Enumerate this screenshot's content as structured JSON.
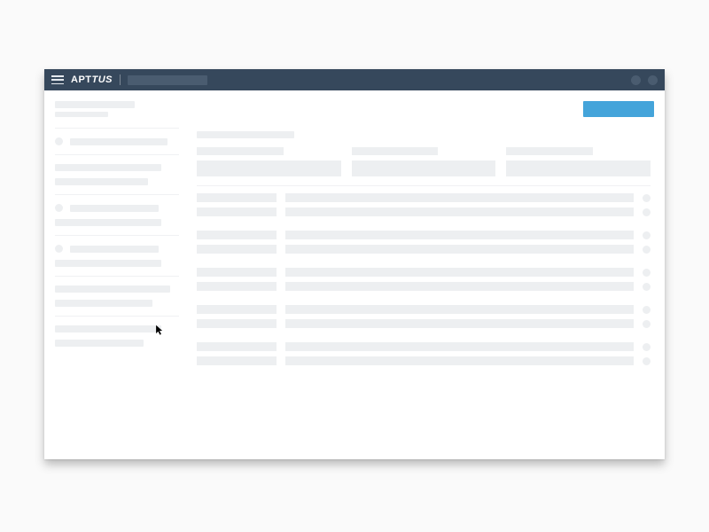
{
  "brand": {
    "apt": "APT",
    "tus": "TUS"
  },
  "header": {
    "hamburger": "hamburger-icon",
    "title_placeholder": "",
    "action_dots": 2
  },
  "toolbar": {
    "heading_primary": "",
    "heading_secondary": "",
    "primary_button_label": ""
  },
  "sidebar": {
    "groups": [
      {
        "rows": [
          {
            "bullet": true,
            "label": ""
          }
        ]
      },
      {
        "rows": [
          {
            "bullet": false,
            "label": ""
          },
          {
            "bullet": false,
            "label": ""
          }
        ]
      },
      {
        "rows": [
          {
            "bullet": true,
            "label": ""
          },
          {
            "bullet": false,
            "label": ""
          }
        ]
      },
      {
        "rows": [
          {
            "bullet": true,
            "label": ""
          },
          {
            "bullet": false,
            "label": ""
          }
        ]
      },
      {
        "rows": [
          {
            "bullet": false,
            "label": ""
          },
          {
            "bullet": false,
            "label": ""
          }
        ]
      },
      {
        "rows": [
          {
            "bullet": false,
            "label": ""
          },
          {
            "bullet": false,
            "label": ""
          }
        ]
      }
    ]
  },
  "main": {
    "section_title": "",
    "cards": [
      {
        "header": "",
        "body": ""
      },
      {
        "header": "",
        "body": ""
      },
      {
        "header": "",
        "body": ""
      }
    ],
    "table": {
      "groups": [
        {
          "rows": [
            {
              "c1": "",
              "c2": "",
              "dot": true
            },
            {
              "c1": "",
              "c2": "",
              "dot": true
            }
          ]
        },
        {
          "rows": [
            {
              "c1": "",
              "c2": "",
              "dot": true
            },
            {
              "c1": "",
              "c2": "",
              "dot": true
            }
          ]
        },
        {
          "rows": [
            {
              "c1": "",
              "c2": "",
              "dot": true
            },
            {
              "c1": "",
              "c2": "",
              "dot": true
            }
          ]
        },
        {
          "rows": [
            {
              "c1": "",
              "c2": "",
              "dot": true
            },
            {
              "c1": "",
              "c2": "",
              "dot": true
            }
          ]
        },
        {
          "rows": [
            {
              "c1": "",
              "c2": "",
              "dot": true
            },
            {
              "c1": "",
              "c2": "",
              "dot": true
            }
          ]
        }
      ]
    }
  },
  "colors": {
    "header_bg": "#36485c",
    "skeleton": "#edeff1",
    "primary": "#44a4da"
  }
}
